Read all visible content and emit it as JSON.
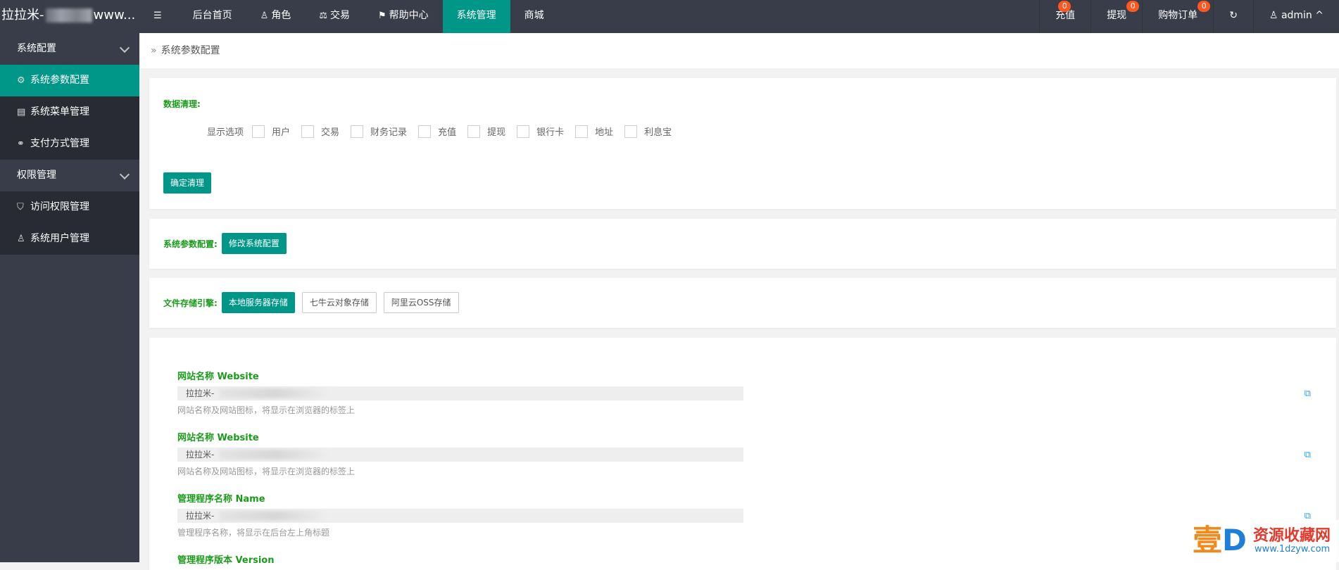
{
  "brand": {
    "prefix": "拉拉米-",
    "suffix": "www..."
  },
  "topnav": [
    {
      "icon": "☰",
      "label": ""
    },
    {
      "icon": "",
      "label": "后台首页"
    },
    {
      "icon": "♙",
      "label": "角色"
    },
    {
      "icon": "⚖",
      "label": "交易"
    },
    {
      "icon": "⚑",
      "label": "帮助中心"
    },
    {
      "icon": "",
      "label": "系统管理",
      "active": true
    },
    {
      "icon": "",
      "label": "商城"
    }
  ],
  "topright": {
    "recharge": {
      "label": "充值",
      "badge": "0"
    },
    "withdraw": {
      "label": "提现",
      "badge": "0"
    },
    "orders": {
      "label": "购物订单",
      "badge": "0"
    },
    "refresh_icon": "↻",
    "user": {
      "label": "admin",
      "icon": "♙"
    }
  },
  "sidebar": {
    "group1": "系统配置",
    "group1_items": [
      "系统参数配置",
      "系统菜单管理",
      "支付方式管理"
    ],
    "group2": "权限管理",
    "group2_items": [
      "访问权限管理",
      "系统用户管理"
    ]
  },
  "breadcrumb": "系统参数配置",
  "data_clean": {
    "title": "数据清理:",
    "display_label": "显示选项",
    "options": [
      "用户",
      "交易",
      "财务记录",
      "充值",
      "提现",
      "银行卡",
      "地址",
      "利息宝"
    ],
    "confirm": "确定清理"
  },
  "sys_params": {
    "title": "系统参数配置:",
    "button": "修改系统配置"
  },
  "storage": {
    "title": "文件存储引擎:",
    "options": [
      "本地服务器存储",
      "七牛云对象存储",
      "阿里云OSS存储"
    ]
  },
  "fields": [
    {
      "title": "网站名称 Website",
      "value": "拉拉米-",
      "help": "网站名称及网站图标，将显示在浏览器的标签上"
    },
    {
      "title": "网站名称 Website",
      "value": "拉拉米-",
      "help": "网站名称及网站图标，将显示在浏览器的标签上"
    },
    {
      "title": "管理程序名称 Name",
      "value": "拉拉米-",
      "help": "管理程序名称，将显示在后台左上角标题"
    },
    {
      "title": "管理程序版本 Version",
      "value": "",
      "help": ""
    }
  ],
  "watermark": {
    "big": "壹",
    "d": "D",
    "line1": "资源收藏网",
    "line2": "www.1dzyw.com"
  }
}
